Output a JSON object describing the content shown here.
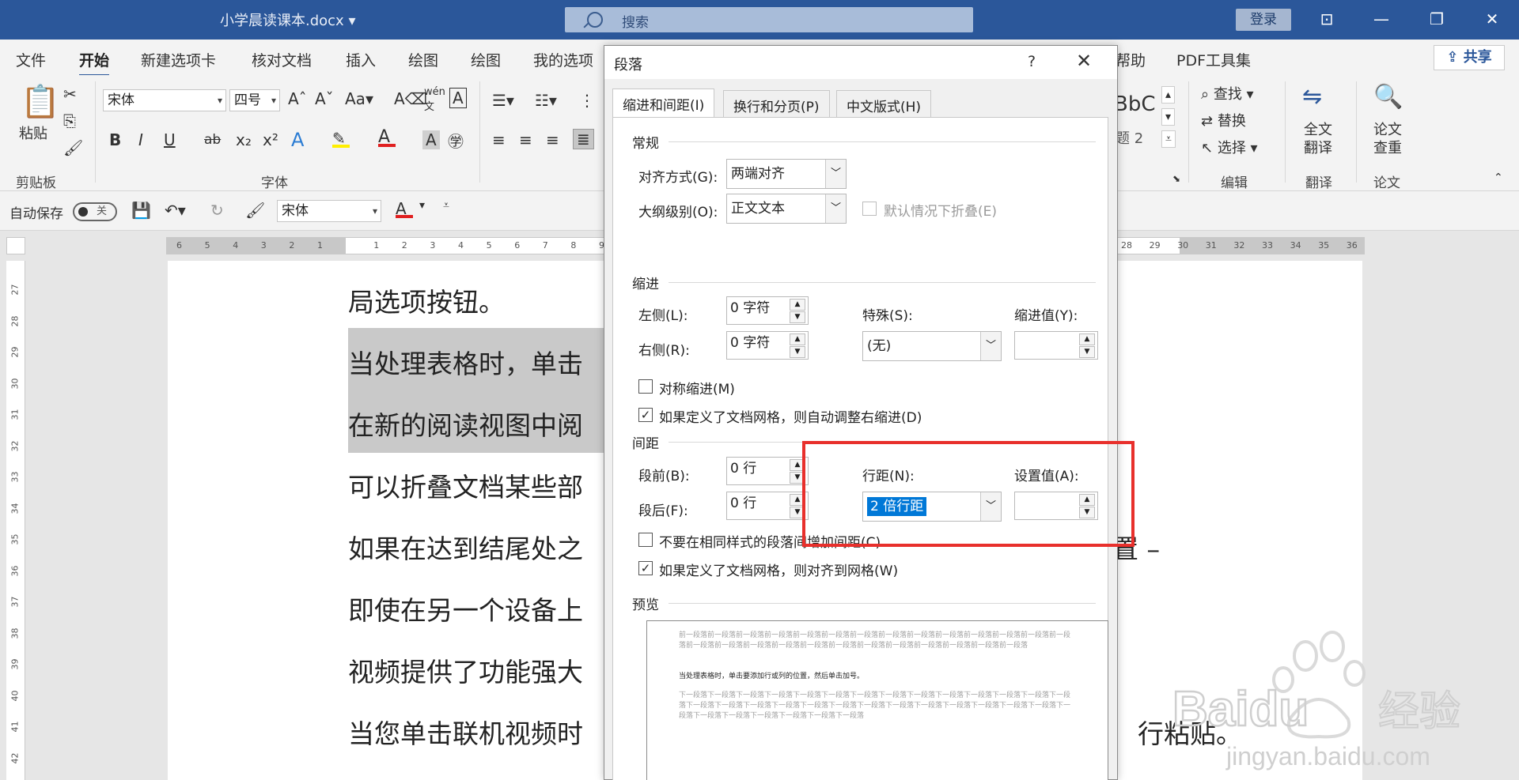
{
  "titlebar": {
    "doc_name": "小学晨读课本.docx",
    "search_placeholder": "搜索",
    "login": "登录"
  },
  "tabs": [
    "文件",
    "开始",
    "新建选项卡",
    "核对文档",
    "插入",
    "绘图",
    "绘图",
    "我的选项"
  ],
  "tabs_right": {
    "help": "帮助",
    "pdf": "PDF工具集",
    "share": "共享"
  },
  "ribbon": {
    "clipboard": {
      "paste": "粘贴",
      "label": "剪贴板"
    },
    "font": {
      "name": "宋体",
      "size": "四号",
      "label": "字体",
      "grow": "A^",
      "shrink": "A˅",
      "change_case": "Aa",
      "wen": "wén文"
    },
    "format_buttons": [
      "B",
      "I",
      "U",
      "ab",
      "x₂",
      "x²"
    ],
    "styles": {
      "preview": "BbC",
      "heading": "题 2"
    },
    "edit": {
      "find": "查找",
      "replace": "替换",
      "select": "选择",
      "label": "编辑"
    },
    "translate": {
      "full": "全文翻译",
      "label": "翻译"
    },
    "paper": {
      "check": "论文查重",
      "label": "论文"
    }
  },
  "qat": {
    "autosave": "自动保存",
    "autosave_state": "关",
    "font": "宋体"
  },
  "ruler": {
    "h_left": [
      "6",
      "5",
      "4",
      "3",
      "2",
      "1",
      "",
      "1",
      "2",
      "3",
      "4",
      "5",
      "6",
      "7",
      "8",
      "9"
    ],
    "h_right": [
      "28",
      "29",
      "30",
      "31",
      "32",
      "33",
      "34",
      "35",
      "36"
    ],
    "v": [
      "27",
      "28",
      "29",
      "30",
      "31",
      "32",
      "33",
      "34",
      "35",
      "36",
      "37",
      "38",
      "39",
      "40",
      "41",
      "42"
    ]
  },
  "document": {
    "lines": [
      "局选项按钮。",
      "当处理表格时，单击",
      "在新的阅读视图中阅",
      "可以折叠文档某些部",
      "如果在达到结尾处之",
      "即使在另一个设备上",
      "视频提供了功能强大",
      "当您单击联机视频时"
    ],
    "right_fragments": {
      "line5": "置 –",
      "line8": "行粘贴。"
    }
  },
  "dialog": {
    "title": "段落",
    "help": "?",
    "tabs": [
      "缩进和间距(I)",
      "换行和分页(P)",
      "中文版式(H)"
    ],
    "general": {
      "heading": "常规",
      "alignment_label": "对齐方式(G):",
      "alignment_value": "两端对齐",
      "outline_label": "大纲级别(O):",
      "outline_value": "正文文本",
      "collapse_label": "默认情况下折叠(E)"
    },
    "indent": {
      "heading": "缩进",
      "left_label": "左侧(L):",
      "left_value": "0 字符",
      "right_label": "右侧(R):",
      "right_value": "0 字符",
      "special_label": "特殊(S):",
      "special_value": "(无)",
      "by_label": "缩进值(Y):",
      "mirror_label": "对称缩进(M)",
      "auto_adjust_label": "如果定义了文档网格，则自动调整右缩进(D)"
    },
    "spacing": {
      "heading": "间距",
      "before_label": "段前(B):",
      "before_value": "0 行",
      "after_label": "段后(F):",
      "after_value": "0 行",
      "line_label": "行距(N):",
      "line_value": "2 倍行距",
      "at_label": "设置值(A):",
      "no_space_label": "不要在相同样式的段落间增加间距(C)",
      "snap_grid_label": "如果定义了文档网格，则对齐到网格(W)"
    },
    "preview": {
      "heading": "预览",
      "prev_text": "前一段落前一段落前一段落前一段落前一段落前一段落前一段落前一段落前一段落前一段落前一段落前一段落前一段落前一段落前一段落前一段落前一段落前一段落前一段落前一段落前一段落前一段落前一段落前一段落前一段落前一段落",
      "current_text": "当处理表格时，单击要添加行或列的位置，然后单击加号。",
      "next_text": "下一段落下一段落下一段落下一段落下一段落下一段落下一段落下一段落下一段落下一段落下一段落下一段落下一段落下一段落下一段落下一段落下一段落下一段落下一段落下一段落下一段落下一段落下一段落下一段落下一段落下一段落下一段落下一段落下一段落下一段落下一段落下一段落下一段落下一段落"
    }
  },
  "watermark": {
    "brand": "Baidu",
    "suffix": "经验",
    "url": "jingyan.baidu.com"
  },
  "colors": {
    "accent": "#2b579a",
    "highlight": "#e8302c",
    "selection": "#0078d7"
  }
}
